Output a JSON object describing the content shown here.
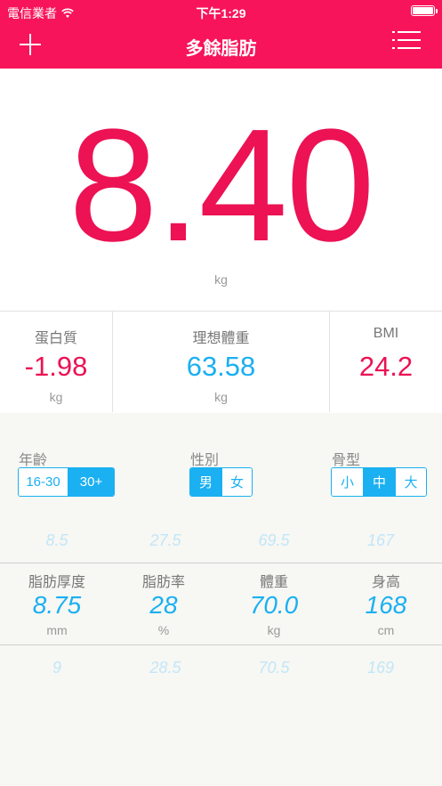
{
  "status_bar": {
    "carrier": "電信業者",
    "time": "下午1:29"
  },
  "header": {
    "title": "多餘脂肪",
    "add_icon": "plus-icon",
    "menu_icon": "list-icon",
    "color": "#f8145a"
  },
  "hero": {
    "value": "8.40",
    "unit": "kg",
    "color": "#ec1254"
  },
  "stats": [
    {
      "label": "蛋白質",
      "value": "-1.98",
      "unit": "kg",
      "color": "#ec1254"
    },
    {
      "label": "理想體重",
      "value": "63.58",
      "unit": "kg",
      "color": "#1ab0f2"
    },
    {
      "label": "BMI",
      "value": "24.2",
      "unit": "",
      "color": "#ec1254"
    }
  ],
  "filters": {
    "age": {
      "label": "年齡",
      "options": [
        "16-30",
        "30+"
      ],
      "selected": "30+"
    },
    "gender": {
      "label": "性別",
      "options": [
        "男",
        "女"
      ],
      "selected": "男"
    },
    "frame": {
      "label": "骨型",
      "options": [
        "小",
        "中",
        "大"
      ],
      "selected": "中"
    }
  },
  "picker": {
    "prev": [
      "8.5",
      "27.5",
      "69.5",
      "167"
    ],
    "current": [
      {
        "label": "脂肪厚度",
        "value": "8.75",
        "unit": "mm"
      },
      {
        "label": "脂肪率",
        "value": "28",
        "unit": "%"
      },
      {
        "label": "體重",
        "value": "70.0",
        "unit": "kg"
      },
      {
        "label": "身高",
        "value": "168",
        "unit": "cm"
      }
    ],
    "next": [
      "9",
      "28.5",
      "70.5",
      "169"
    ]
  }
}
